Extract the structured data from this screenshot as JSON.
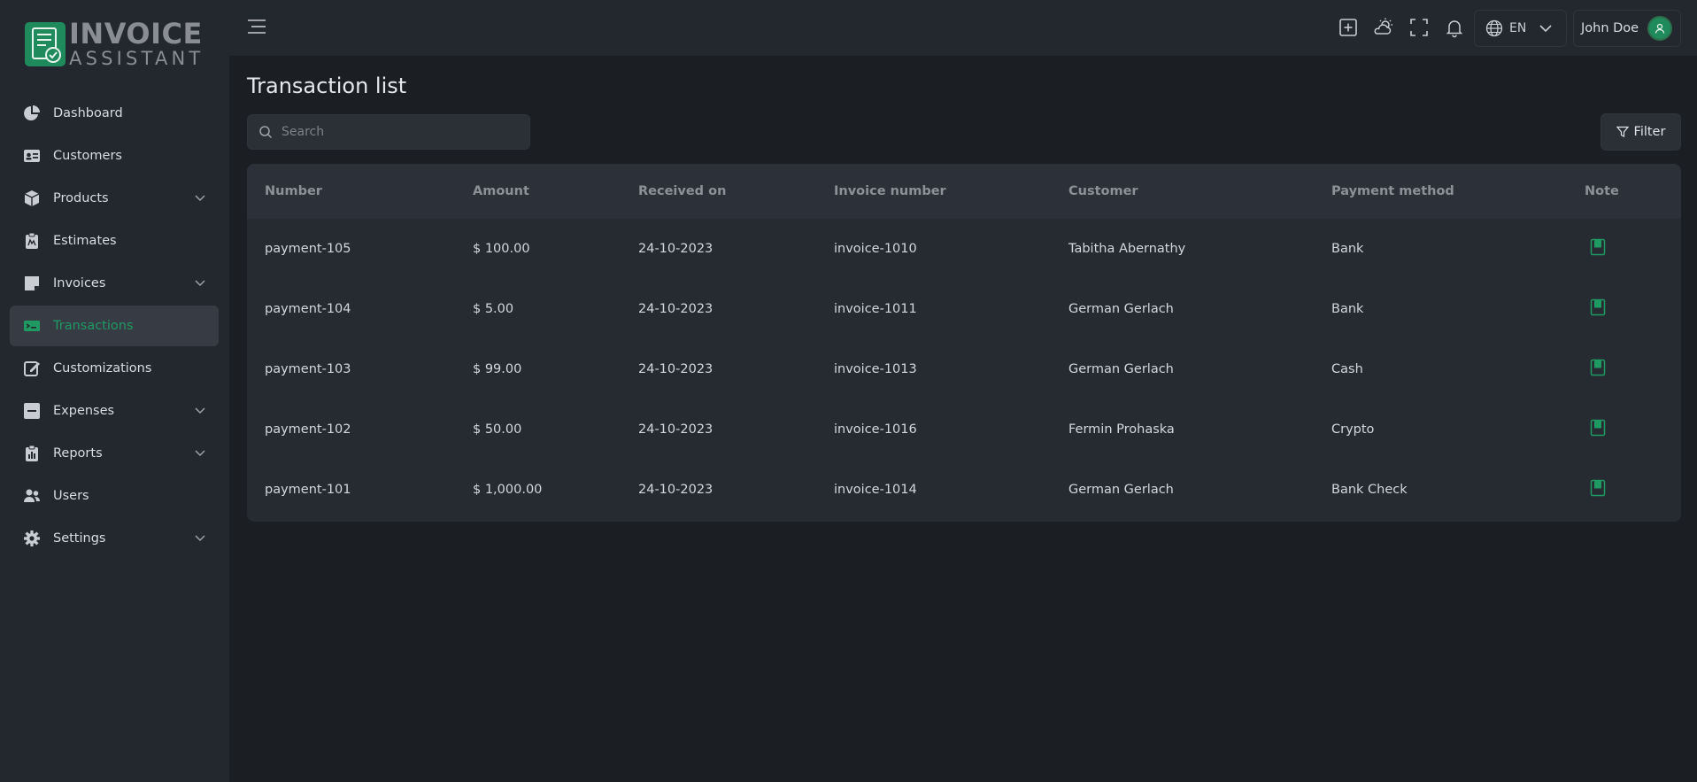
{
  "logo": {
    "title": "INVOICE",
    "subtitle": "ASSISTANT"
  },
  "sidebar": {
    "items": [
      {
        "label": "Dashboard",
        "icon": "pie-chart-icon",
        "expandable": false
      },
      {
        "label": "Customers",
        "icon": "id-card-icon",
        "expandable": false
      },
      {
        "label": "Products",
        "icon": "box-icon",
        "expandable": true
      },
      {
        "label": "Estimates",
        "icon": "clipboard-icon",
        "expandable": false
      },
      {
        "label": "Invoices",
        "icon": "invoice-icon",
        "expandable": true
      },
      {
        "label": "Transactions",
        "icon": "money-icon",
        "expandable": false,
        "active": true
      },
      {
        "label": "Customizations",
        "icon": "edit-icon",
        "expandable": false
      },
      {
        "label": "Expenses",
        "icon": "minus-square-icon",
        "expandable": true
      },
      {
        "label": "Reports",
        "icon": "report-icon",
        "expandable": true
      },
      {
        "label": "Users",
        "icon": "users-icon",
        "expandable": false
      },
      {
        "label": "Settings",
        "icon": "gear-icon",
        "expandable": true
      }
    ]
  },
  "header": {
    "language": "EN",
    "user_name": "John Doe"
  },
  "main": {
    "title": "Transaction list",
    "search_placeholder": "Search",
    "filter_label": "Filter",
    "columns": [
      "Number",
      "Amount",
      "Received on",
      "Invoice number",
      "Customer",
      "Payment method",
      "Note"
    ],
    "rows": [
      {
        "number": "payment-105",
        "amount": "$ 100.00",
        "received_on": "24-10-2023",
        "invoice": "invoice-1010",
        "customer": "Tabitha Abernathy",
        "method": "Bank"
      },
      {
        "number": "payment-104",
        "amount": "$ 5.00",
        "received_on": "24-10-2023",
        "invoice": "invoice-1011",
        "customer": "German Gerlach",
        "method": "Bank"
      },
      {
        "number": "payment-103",
        "amount": "$ 99.00",
        "received_on": "24-10-2023",
        "invoice": "invoice-1013",
        "customer": "German Gerlach",
        "method": "Cash"
      },
      {
        "number": "payment-102",
        "amount": "$ 50.00",
        "received_on": "24-10-2023",
        "invoice": "invoice-1016",
        "customer": "Fermin Prohaska",
        "method": "Crypto"
      },
      {
        "number": "payment-101",
        "amount": "$ 1,000.00",
        "received_on": "24-10-2023",
        "invoice": "invoice-1014",
        "customer": "German Gerlach",
        "method": "Bank Check"
      }
    ]
  },
  "colors": {
    "accent": "#1f8a5c",
    "active_text": "#1f9a63",
    "background": "#1b1e23",
    "panel": "#23272e"
  }
}
